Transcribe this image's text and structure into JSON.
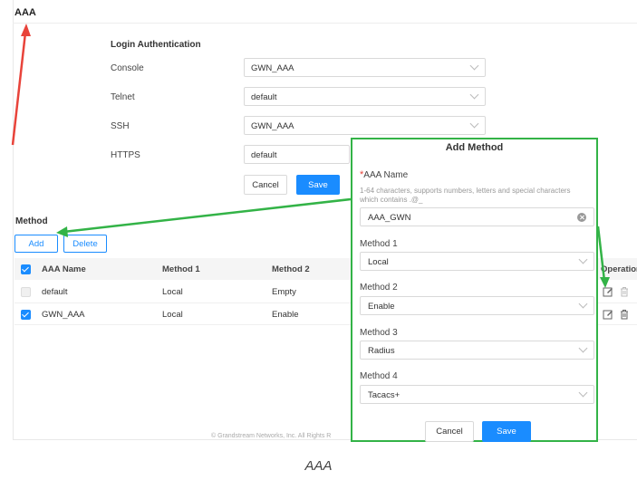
{
  "page": {
    "title": "AAA"
  },
  "login_auth": {
    "section_title": "Login Authentication",
    "fields": [
      {
        "label": "Console",
        "value": "GWN_AAA"
      },
      {
        "label": "Telnet",
        "value": "default"
      },
      {
        "label": "SSH",
        "value": "GWN_AAA"
      },
      {
        "label": "HTTPS",
        "value": "default"
      }
    ],
    "cancel_label": "Cancel",
    "save_label": "Save"
  },
  "method": {
    "section_title": "Method",
    "add_label": "Add",
    "delete_label": "Delete",
    "columns": [
      "AAA Name",
      "Method 1",
      "Method 2",
      "Operation"
    ],
    "rows": [
      {
        "checked": false,
        "name": "default",
        "method1": "Local",
        "method2": "Empty"
      },
      {
        "checked": true,
        "name": "GWN_AAA",
        "method1": "Local",
        "method2": "Enable"
      }
    ],
    "header_checked": true
  },
  "footer": {
    "text": "© Grandstream Networks, Inc. All Rights R"
  },
  "modal": {
    "title": "Add Method",
    "name_label": "AAA Name",
    "required_mark": "*",
    "name_hint": "1-64 characters, supports numbers, letters and special characters which contains .@_",
    "name_value": "AAA_GWN",
    "method1_label": "Method 1",
    "method1_value": "Local",
    "method2_label": "Method 2",
    "method2_value": "Enable",
    "method3_label": "Method 3",
    "method3_value": "Radius",
    "method4_label": "Method 4",
    "method4_value": "Tacacs+",
    "cancel_label": "Cancel",
    "save_label": "Save"
  },
  "caption": "AAA",
  "colors": {
    "accent": "#1a8cff",
    "highlight_box": "#33b347",
    "arrow_red": "#e8433a",
    "arrow_green": "#33b347"
  },
  "icons": [
    "edit-icon",
    "delete-icon",
    "clear-icon",
    "chevron-down-icon",
    "checkbox-icon"
  ]
}
